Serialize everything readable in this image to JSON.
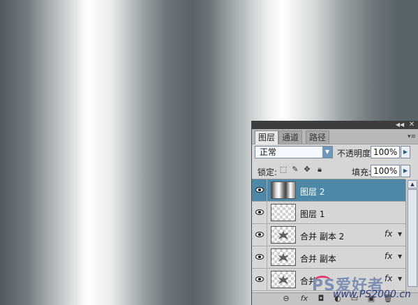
{
  "panel": {
    "titlebar": {
      "collapse_icon": "double-chevron",
      "close_icon": "close"
    },
    "tabs": [
      {
        "label": "图层",
        "active": true
      },
      {
        "label": "通道",
        "active": false
      },
      {
        "label": "路径",
        "active": false
      }
    ],
    "blend_mode": "正常",
    "opacity_label": "不透明度:",
    "opacity_value": "100%",
    "lock_label": "锁定:",
    "fill_label": "填充:",
    "fill_value": "100%",
    "layers": [
      {
        "name": "图层 2",
        "selected": true,
        "thumb": "gradient",
        "fx": ""
      },
      {
        "name": "图层 1",
        "selected": false,
        "thumb": "transparent",
        "fx": ""
      },
      {
        "name": "合并 副本 2",
        "selected": false,
        "thumb": "shape",
        "fx": "fx"
      },
      {
        "name": "合并 副本",
        "selected": false,
        "thumb": "shape",
        "fx": "fx"
      },
      {
        "name": "合并",
        "selected": false,
        "thumb": "shape",
        "fx": "fx"
      }
    ]
  },
  "watermark": {
    "logo_text": "PS爱好者",
    "site": "www.PS2000.cn"
  }
}
